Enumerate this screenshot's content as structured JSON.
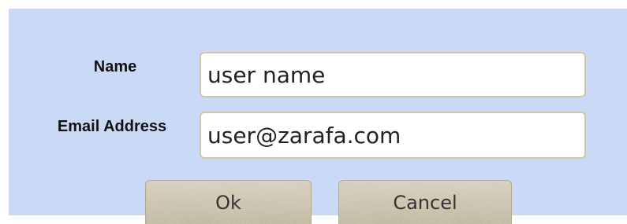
{
  "form": {
    "name_label": "Name",
    "name_value": "user name",
    "email_label": "Email Address",
    "email_value": "user@zarafa.com"
  },
  "buttons": {
    "ok_label": "Ok",
    "cancel_label": "Cancel"
  },
  "colors": {
    "dialog_background": "#c9d9f6",
    "button_background": "#cbc3ad",
    "field_border": "#cfc7a6"
  }
}
